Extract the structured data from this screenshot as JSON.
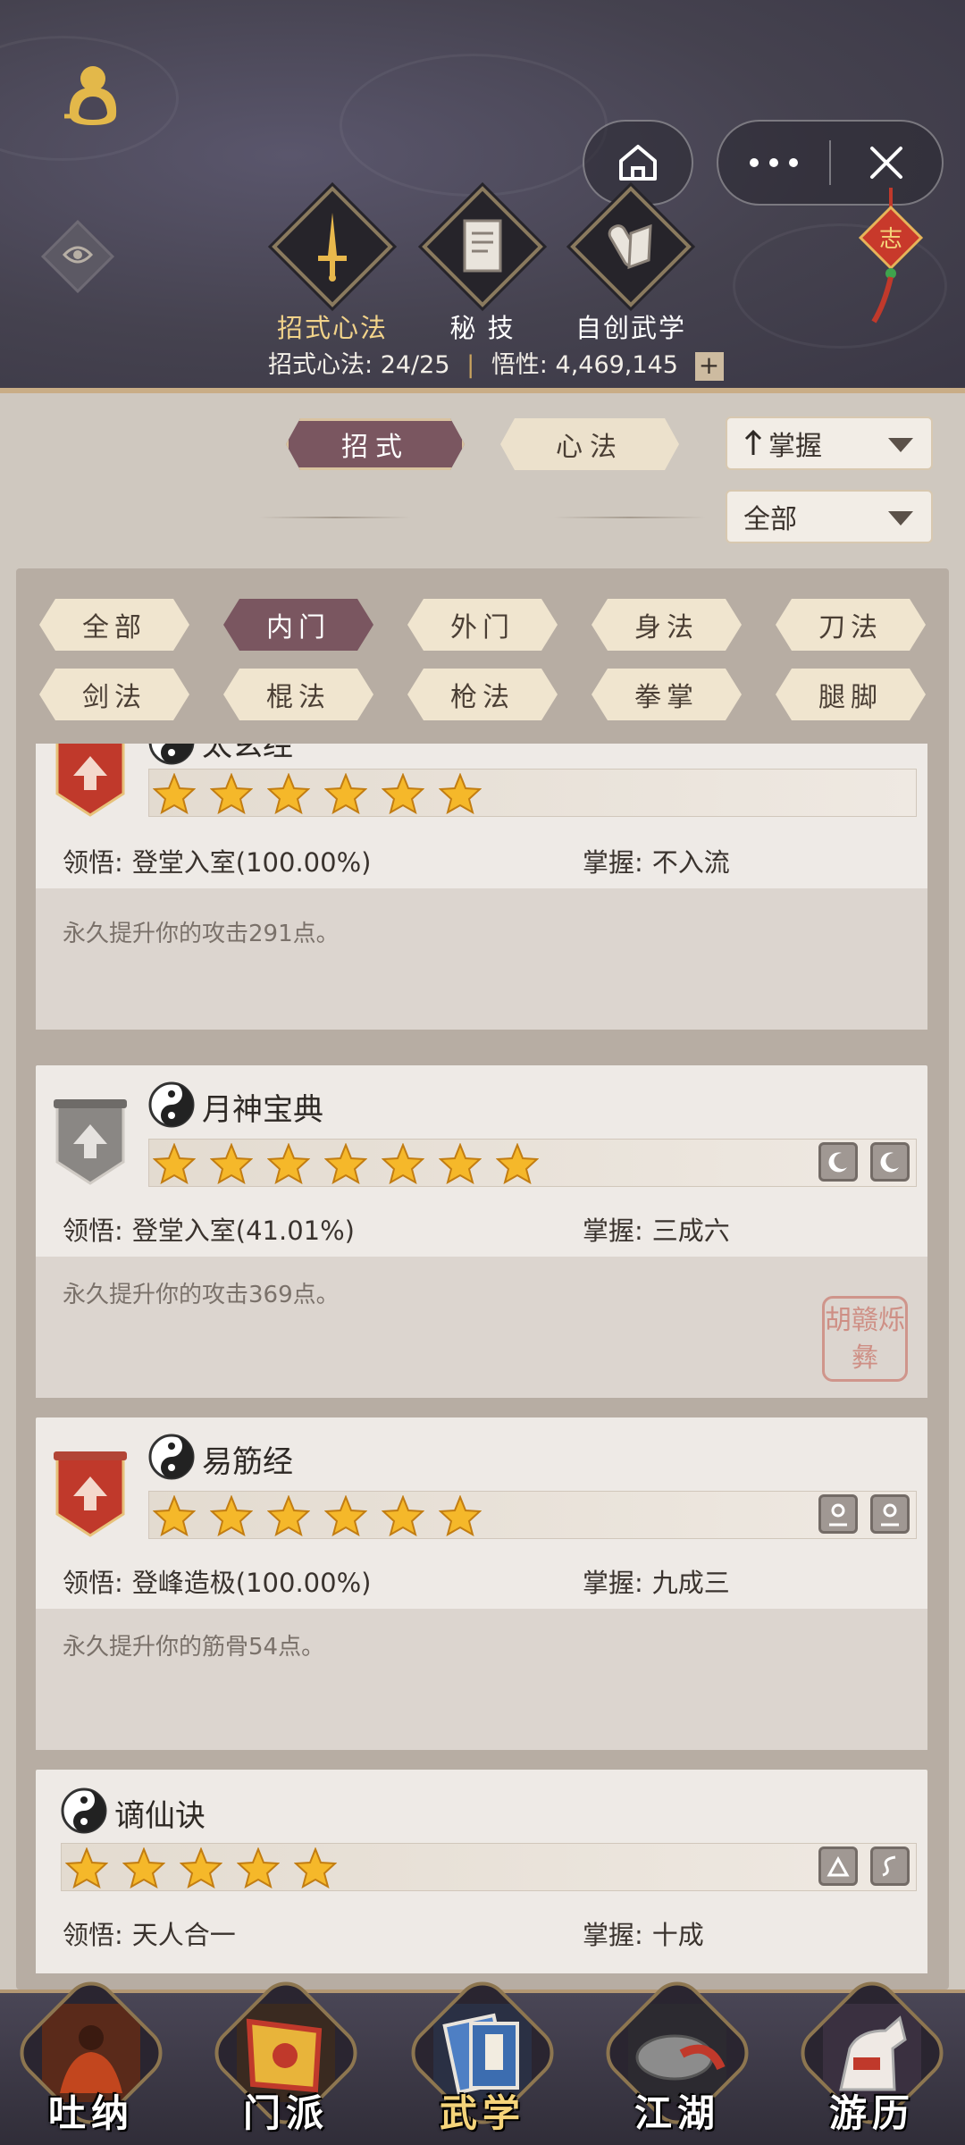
{
  "header": {
    "categories": [
      {
        "label": "招式心法",
        "icon": "sword-icon",
        "active": true
      },
      {
        "label": "秘 技",
        "icon": "book-icon",
        "active": false
      },
      {
        "label": "自创武学",
        "icon": "scroll-icon",
        "active": false
      }
    ],
    "stats": {
      "count_label": "招式心法:",
      "count_value": "24/25",
      "insight_label": "悟性:",
      "insight_value": "4,469,145",
      "plus": "+"
    },
    "knot_char": "志"
  },
  "tabs": {
    "zhaoshi": "招式",
    "xinfa": "心法"
  },
  "dropdowns": {
    "sort": "掌握",
    "filter": "全部"
  },
  "chips": [
    "全部",
    "内门",
    "外门",
    "身法",
    "刀法",
    "剑法",
    "棍法",
    "枪法",
    "拳掌",
    "腿脚"
  ],
  "selected_chip": "内门",
  "skills": [
    {
      "name": "太玄经",
      "stars": 6,
      "insight_label": "领悟:",
      "insight": "登堂入室(100.00%)",
      "mastery_label": "掌握:",
      "mastery": "不入流",
      "desc": "永久提升你的攻击291点。",
      "badge": "red"
    },
    {
      "name": "月神宝典",
      "stars": 7,
      "insight_label": "领悟:",
      "insight": "登堂入室(41.01%)",
      "mastery_label": "掌握:",
      "mastery": "三成六",
      "desc": "永久提升你的攻击369点。",
      "badge": "gray",
      "icons": [
        "moon-icon",
        "moon-icon"
      ],
      "seal": "胡赣烁彝"
    },
    {
      "name": "易筋经",
      "stars": 6,
      "insight_label": "领悟:",
      "insight": "登峰造极(100.00%)",
      "mastery_label": "掌握:",
      "mastery": "九成三",
      "desc": "永久提升你的筋骨54点。",
      "badge": "red",
      "icons": [
        "figure-icon",
        "figure-icon"
      ]
    },
    {
      "name": "谪仙诀",
      "stars": 5,
      "insight_label": "领悟:",
      "insight": "天人合一",
      "mastery_label": "掌握:",
      "mastery": "十成",
      "badge": "none",
      "icons": [
        "mountain-icon",
        "swirl-icon"
      ]
    }
  ],
  "nav": [
    {
      "label": "吐纳",
      "active": false
    },
    {
      "label": "门派",
      "active": false
    },
    {
      "label": "武学",
      "active": true
    },
    {
      "label": "江湖",
      "active": false
    },
    {
      "label": "游历",
      "active": false
    }
  ],
  "colors": {
    "accent": "#7a5660",
    "gold": "#f2d38a",
    "star": "#f5b82a",
    "badge_red": "#c0392b"
  }
}
